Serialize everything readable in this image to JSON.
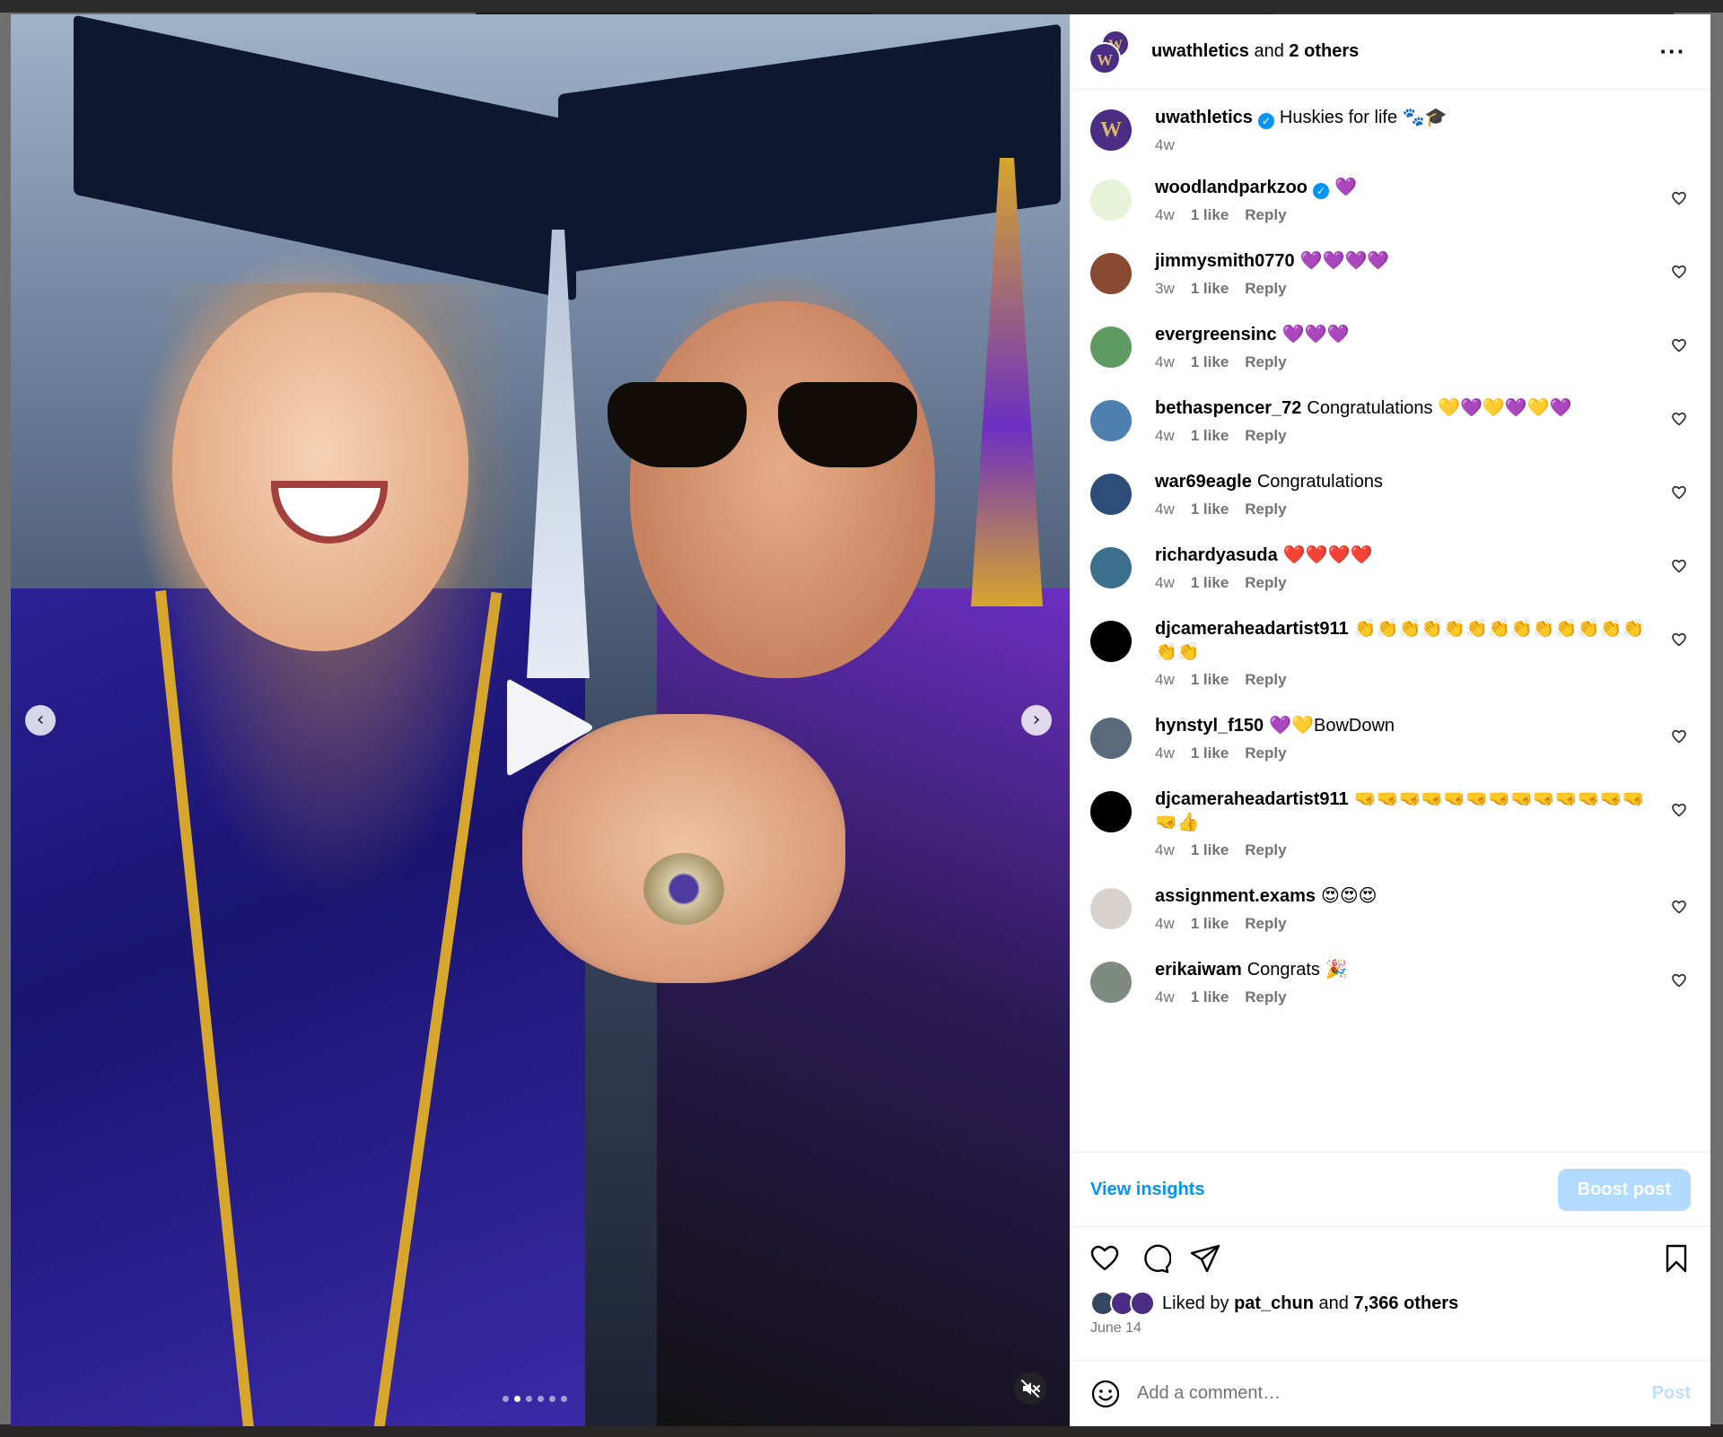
{
  "header": {
    "account": "uwathletics",
    "and_text": "and",
    "others": "2 others",
    "more_icon": "more-horizontal-icon"
  },
  "caption": {
    "user": "uwathletics",
    "text": "Huskies for life 🐾🎓",
    "time": "4w"
  },
  "comments": [
    {
      "user": "woodlandparkzoo",
      "verified": true,
      "text": "💜",
      "time": "4w",
      "likes": "1 like",
      "reply": "Reply",
      "avatar_color": "#e9f3d9"
    },
    {
      "user": "jimmysmith0770",
      "verified": false,
      "text": "💜💜💜💜",
      "time": "3w",
      "likes": "1 like",
      "reply": "Reply",
      "avatar_color": "#8a4a32"
    },
    {
      "user": "evergreensinc",
      "verified": false,
      "text": "💜💜💜",
      "time": "4w",
      "likes": "1 like",
      "reply": "Reply",
      "avatar_color": "#5d9b62"
    },
    {
      "user": "bethaspencer_72",
      "verified": false,
      "text": "Congratulations 💛💜💛💜💛💜",
      "time": "4w",
      "likes": "1 like",
      "reply": "Reply",
      "avatar_color": "#4f7fae"
    },
    {
      "user": "war69eagle",
      "verified": false,
      "text": "Congratulations",
      "time": "4w",
      "likes": "1 like",
      "reply": "Reply",
      "avatar_color": "#2c4e78"
    },
    {
      "user": "richardyasuda",
      "verified": false,
      "text": "❤️❤️❤️❤️",
      "time": "4w",
      "likes": "1 like",
      "reply": "Reply",
      "avatar_color": "#3d6f8e"
    },
    {
      "user": "djcameraheadartist911",
      "verified": false,
      "text": "👏👏👏👏👏👏👏👏👏👏👏👏👏👏👏",
      "time": "4w",
      "likes": "1 like",
      "reply": "Reply",
      "avatar_color": "#000000"
    },
    {
      "user": "hynstyl_f150",
      "verified": false,
      "text": "💜💛BowDown",
      "time": "4w",
      "likes": "1 like",
      "reply": "Reply",
      "avatar_color": "#5b6a7b"
    },
    {
      "user": "djcameraheadartist911",
      "verified": false,
      "text": "🤜🤜🤜🤜🤜🤜🤜🤜🤜🤜🤜🤜🤜🤜👍",
      "time": "4w",
      "likes": "1 like",
      "reply": "Reply",
      "avatar_color": "#000000"
    },
    {
      "user": "assignment.exams",
      "verified": false,
      "text": "😍😍😍",
      "time": "4w",
      "likes": "1 like",
      "reply": "Reply",
      "avatar_color": "#d8d2cf"
    },
    {
      "user": "erikaiwam",
      "verified": false,
      "text": "Congrats 🎉",
      "time": "4w",
      "likes": "1 like",
      "reply": "Reply",
      "avatar_color": "#7f8a80"
    }
  ],
  "insights": {
    "view_label": "View insights",
    "boost_label": "Boost post"
  },
  "likes": {
    "prefix": "Liked by",
    "user": "pat_chun",
    "and_text": "and",
    "others": "7,366 others"
  },
  "date": "June 14",
  "add_comment": {
    "placeholder": "Add a comment…",
    "post_label": "Post"
  },
  "media": {
    "slide_count": 6,
    "active_slide": 2,
    "prev_arrow": "‹",
    "next_arrow": "›"
  },
  "colors": {
    "accent": "#0095f6",
    "boost_disabled": "#b3dbff",
    "uw_purple": "#4b2e83",
    "uw_gold": "#d7b86a"
  }
}
